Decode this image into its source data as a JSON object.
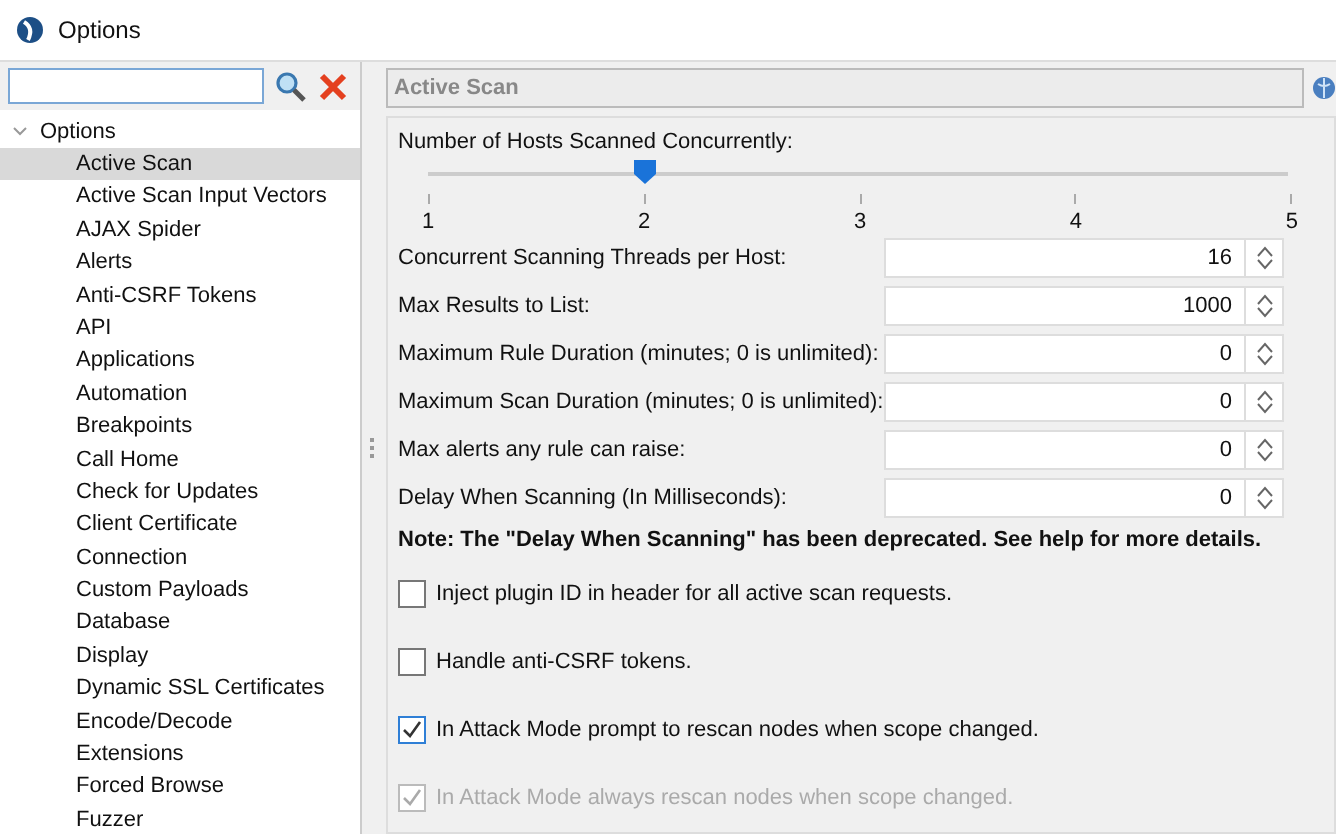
{
  "window": {
    "title": "Options"
  },
  "sidebar": {
    "tree": {
      "label": "Options",
      "expanded": true,
      "children": [
        {
          "label": "Active Scan",
          "selected": true
        },
        {
          "label": "Active Scan Input Vectors",
          "selected": false
        },
        {
          "label": "AJAX Spider",
          "selected": false
        },
        {
          "label": "Alerts",
          "selected": false
        },
        {
          "label": "Anti-CSRF Tokens",
          "selected": false
        },
        {
          "label": "API",
          "selected": false
        },
        {
          "label": "Applications",
          "selected": false
        },
        {
          "label": "Automation",
          "selected": false
        },
        {
          "label": "Breakpoints",
          "selected": false
        },
        {
          "label": "Call Home",
          "selected": false
        },
        {
          "label": "Check for Updates",
          "selected": false
        },
        {
          "label": "Client Certificate",
          "selected": false
        },
        {
          "label": "Connection",
          "selected": false
        },
        {
          "label": "Custom Payloads",
          "selected": false
        },
        {
          "label": "Database",
          "selected": false
        },
        {
          "label": "Display",
          "selected": false
        },
        {
          "label": "Dynamic SSL Certificates",
          "selected": false
        },
        {
          "label": "Encode/Decode",
          "selected": false
        },
        {
          "label": "Extensions",
          "selected": false
        },
        {
          "label": "Forced Browse",
          "selected": false
        },
        {
          "label": "Fuzzer",
          "selected": false
        }
      ]
    }
  },
  "panel": {
    "title": "Active Scan",
    "slider": {
      "label": "Number of Hosts Scanned Concurrently:",
      "level": 0.25,
      "ticks": [
        "1",
        "2",
        "3",
        "4",
        "5"
      ]
    },
    "fields": [
      {
        "label": "Concurrent Scanning Threads per Host:",
        "value": "16"
      },
      {
        "label": "Max Results to List:",
        "value": "1000"
      },
      {
        "label": "Maximum Rule Duration (minutes; 0 is unlimited):",
        "value": "0"
      },
      {
        "label": "Maximum Scan Duration (minutes; 0 is unlimited):",
        "value": "0"
      },
      {
        "label": "Max alerts any rule can raise:",
        "value": "0"
      },
      {
        "label": "Delay When Scanning (In Milliseconds):",
        "value": "0"
      }
    ],
    "note": "Note: The \"Delay When Scanning\" has been deprecated. See help for more details.",
    "checkboxes": [
      {
        "label": "Inject plugin ID in header for all active scan requests.",
        "checked": false,
        "disabled": false
      },
      {
        "label": "Handle anti-CSRF tokens.",
        "checked": false,
        "disabled": false
      },
      {
        "label": "In Attack Mode prompt to rescan nodes when scope changed.",
        "checked": true,
        "disabled": false
      },
      {
        "label": "In Attack Mode always rescan nodes when scope changed.",
        "checked": true,
        "disabled": true
      }
    ]
  }
}
